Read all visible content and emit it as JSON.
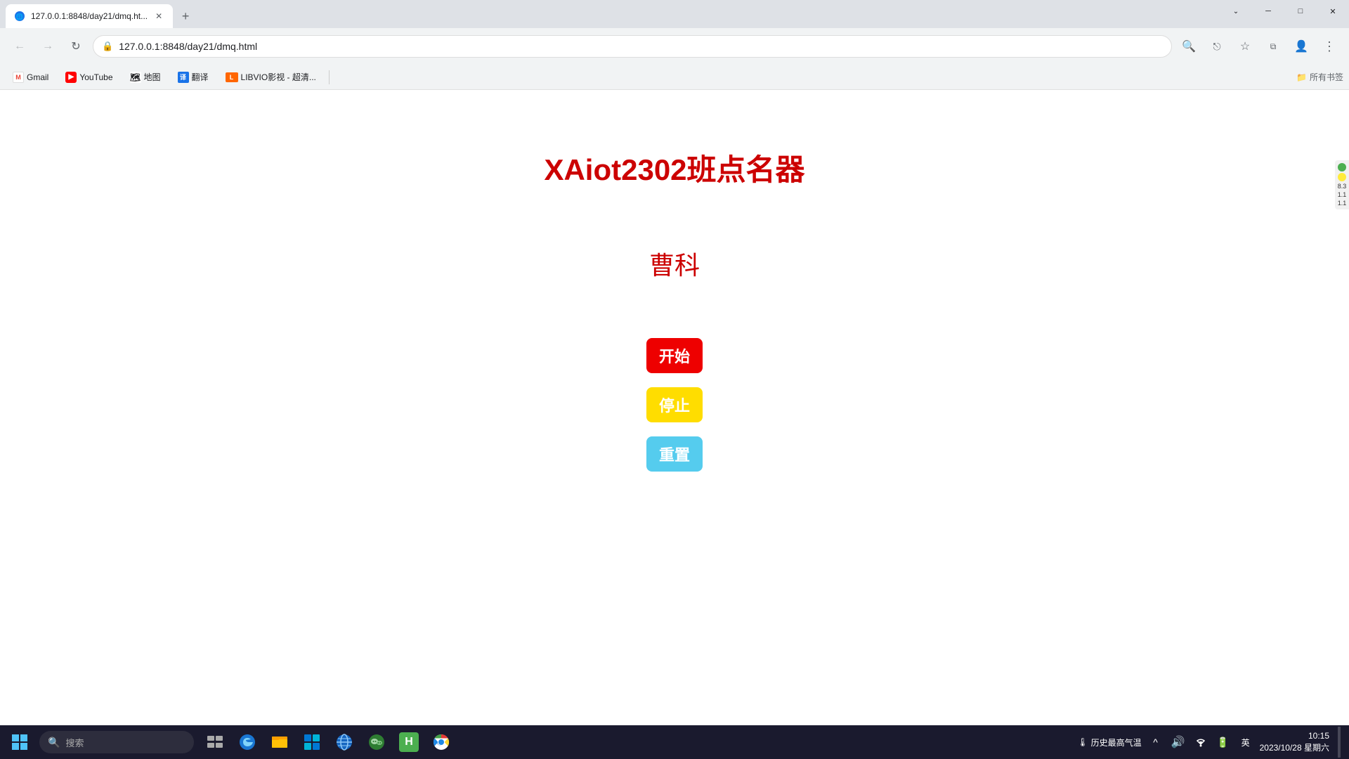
{
  "browser": {
    "tab": {
      "title": "127.0.0.1:8848/day21/dmq.ht...",
      "url": "127.0.0.1:8848/day21/dmq.html"
    },
    "window_controls": {
      "minimize": "─",
      "maximize": "□",
      "close": "✕"
    },
    "bookmarks": [
      {
        "id": "gmail",
        "label": "Gmail",
        "color": "#fff",
        "icon": "M"
      },
      {
        "id": "youtube",
        "label": "YouTube",
        "color": "#ff0000",
        "icon": "▶"
      },
      {
        "id": "maps",
        "label": "地图",
        "color": "#4caf50",
        "icon": "📍"
      },
      {
        "id": "translate",
        "label": "翻译",
        "color": "#1a73e8",
        "icon": "译"
      },
      {
        "id": "libvio",
        "label": "LIBVIO影视 - 超清...",
        "color": "#ff6600",
        "icon": "L"
      }
    ],
    "bookmarks_right_label": "所有书签"
  },
  "page": {
    "title": "XAiot2302班点名器",
    "selected_name": "曹科",
    "buttons": {
      "start": "开始",
      "stop": "停止",
      "reset": "重置"
    }
  },
  "side_panel": {
    "dot1_color": "#4caf50",
    "dot2_color": "#ffeb3b",
    "numbers": [
      "8.3",
      "1.1"
    ]
  },
  "taskbar": {
    "search_placeholder": "搜索",
    "apps": [
      "⊞",
      "📁",
      "🛒",
      "🌐",
      "💬",
      "📗",
      "🌍"
    ],
    "right": {
      "weather_label": "历史最高气温",
      "time": "10:15",
      "date": "2023/10/28 星期六",
      "lang": "英"
    }
  }
}
